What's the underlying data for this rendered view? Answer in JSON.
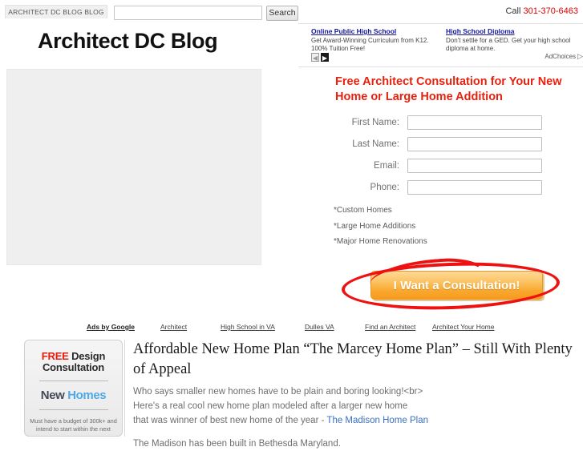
{
  "topbar": {
    "blog_tab": "ARCHITECT DC BLOG BLOG",
    "search_value": "",
    "search_placeholder": "",
    "search_button": "Search",
    "call_label": "Call ",
    "phone": "301-370-6463"
  },
  "site": {
    "title": "Architect DC Blog"
  },
  "header_ads": {
    "ads": [
      {
        "title": "Online Public High School",
        "desc": "Get Award-Winning Curriculum from K12. 100% Tuition Free!"
      },
      {
        "title": "High School Diploma",
        "desc": "Don't settle for a GED. Get your high school diploma at home."
      }
    ],
    "prev_glyph": "◀",
    "next_glyph": "▶",
    "adchoices_label": "AdChoices",
    "adchoices_glyph": "▷"
  },
  "lead": {
    "headline": "Free Architect Consultation for Your New Home or Large Home Addition",
    "headline_color": "#e8210f",
    "fields": [
      {
        "label": "First Name:",
        "value": "",
        "placeholder": ""
      },
      {
        "label": "Last Name:",
        "value": "",
        "placeholder": ""
      },
      {
        "label": "Email:",
        "value": "",
        "placeholder": ""
      },
      {
        "label": "Phone:",
        "value": "",
        "placeholder": ""
      }
    ],
    "bullets": [
      "*Custom Homes",
      "*Large Home Additions",
      "*Major Home Renovations"
    ],
    "cta_label": "I Want a Consultation!",
    "cta_color": "#f9a830",
    "annotation_color": "#ee1111"
  },
  "ads_links": {
    "brand": "Ads by Google",
    "links": [
      "Architect",
      "High School in VA",
      "Dulles VA",
      "Find an Architect",
      "Architect Your Home"
    ]
  },
  "sidebar_ad": {
    "line1_free": "FREE",
    "line1_rest": " Design",
    "line2": "Consultation",
    "line3_new": "New ",
    "line3_homes": "Homes",
    "fine_print": "Must have a budget of 300k+ and intend to start within the next"
  },
  "article": {
    "title": "Affordable New Home Plan “The Marcey Home Plan” – Still With Plenty of Appeal",
    "para1_line1": "Who says smaller new homes have to be plain and boring looking!<br>",
    "para1_line2": "Here's a real cool new home plan modeled after a larger new home",
    "para1_line3_pre": "that was winner of best new home of the year - ",
    "para1_link": "The Madison Home Plan",
    "para2": "The Madison has been built in Bethesda Maryland."
  }
}
